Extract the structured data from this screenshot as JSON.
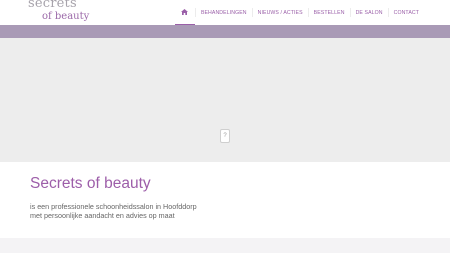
{
  "logo": {
    "line1": "secrets",
    "line2": "of beauty"
  },
  "nav": {
    "home_icon": "home-icon",
    "items": [
      "BEHANDELINGEN",
      "NIEUWS / ACTIES",
      "BESTELLEN",
      "DE SALON",
      "CONTACT"
    ]
  },
  "slider": {
    "placeholder_icon": "?"
  },
  "intro": {
    "title": "Secrets of beauty",
    "line1": "is een professionele schoonheidssalon in Hoofddorp",
    "line2": "met persoonlijke aandacht en advies op maat"
  },
  "colors": {
    "accent": "#9a5fa8",
    "band": "#a99ab6",
    "slider_bg": "#ededed"
  }
}
